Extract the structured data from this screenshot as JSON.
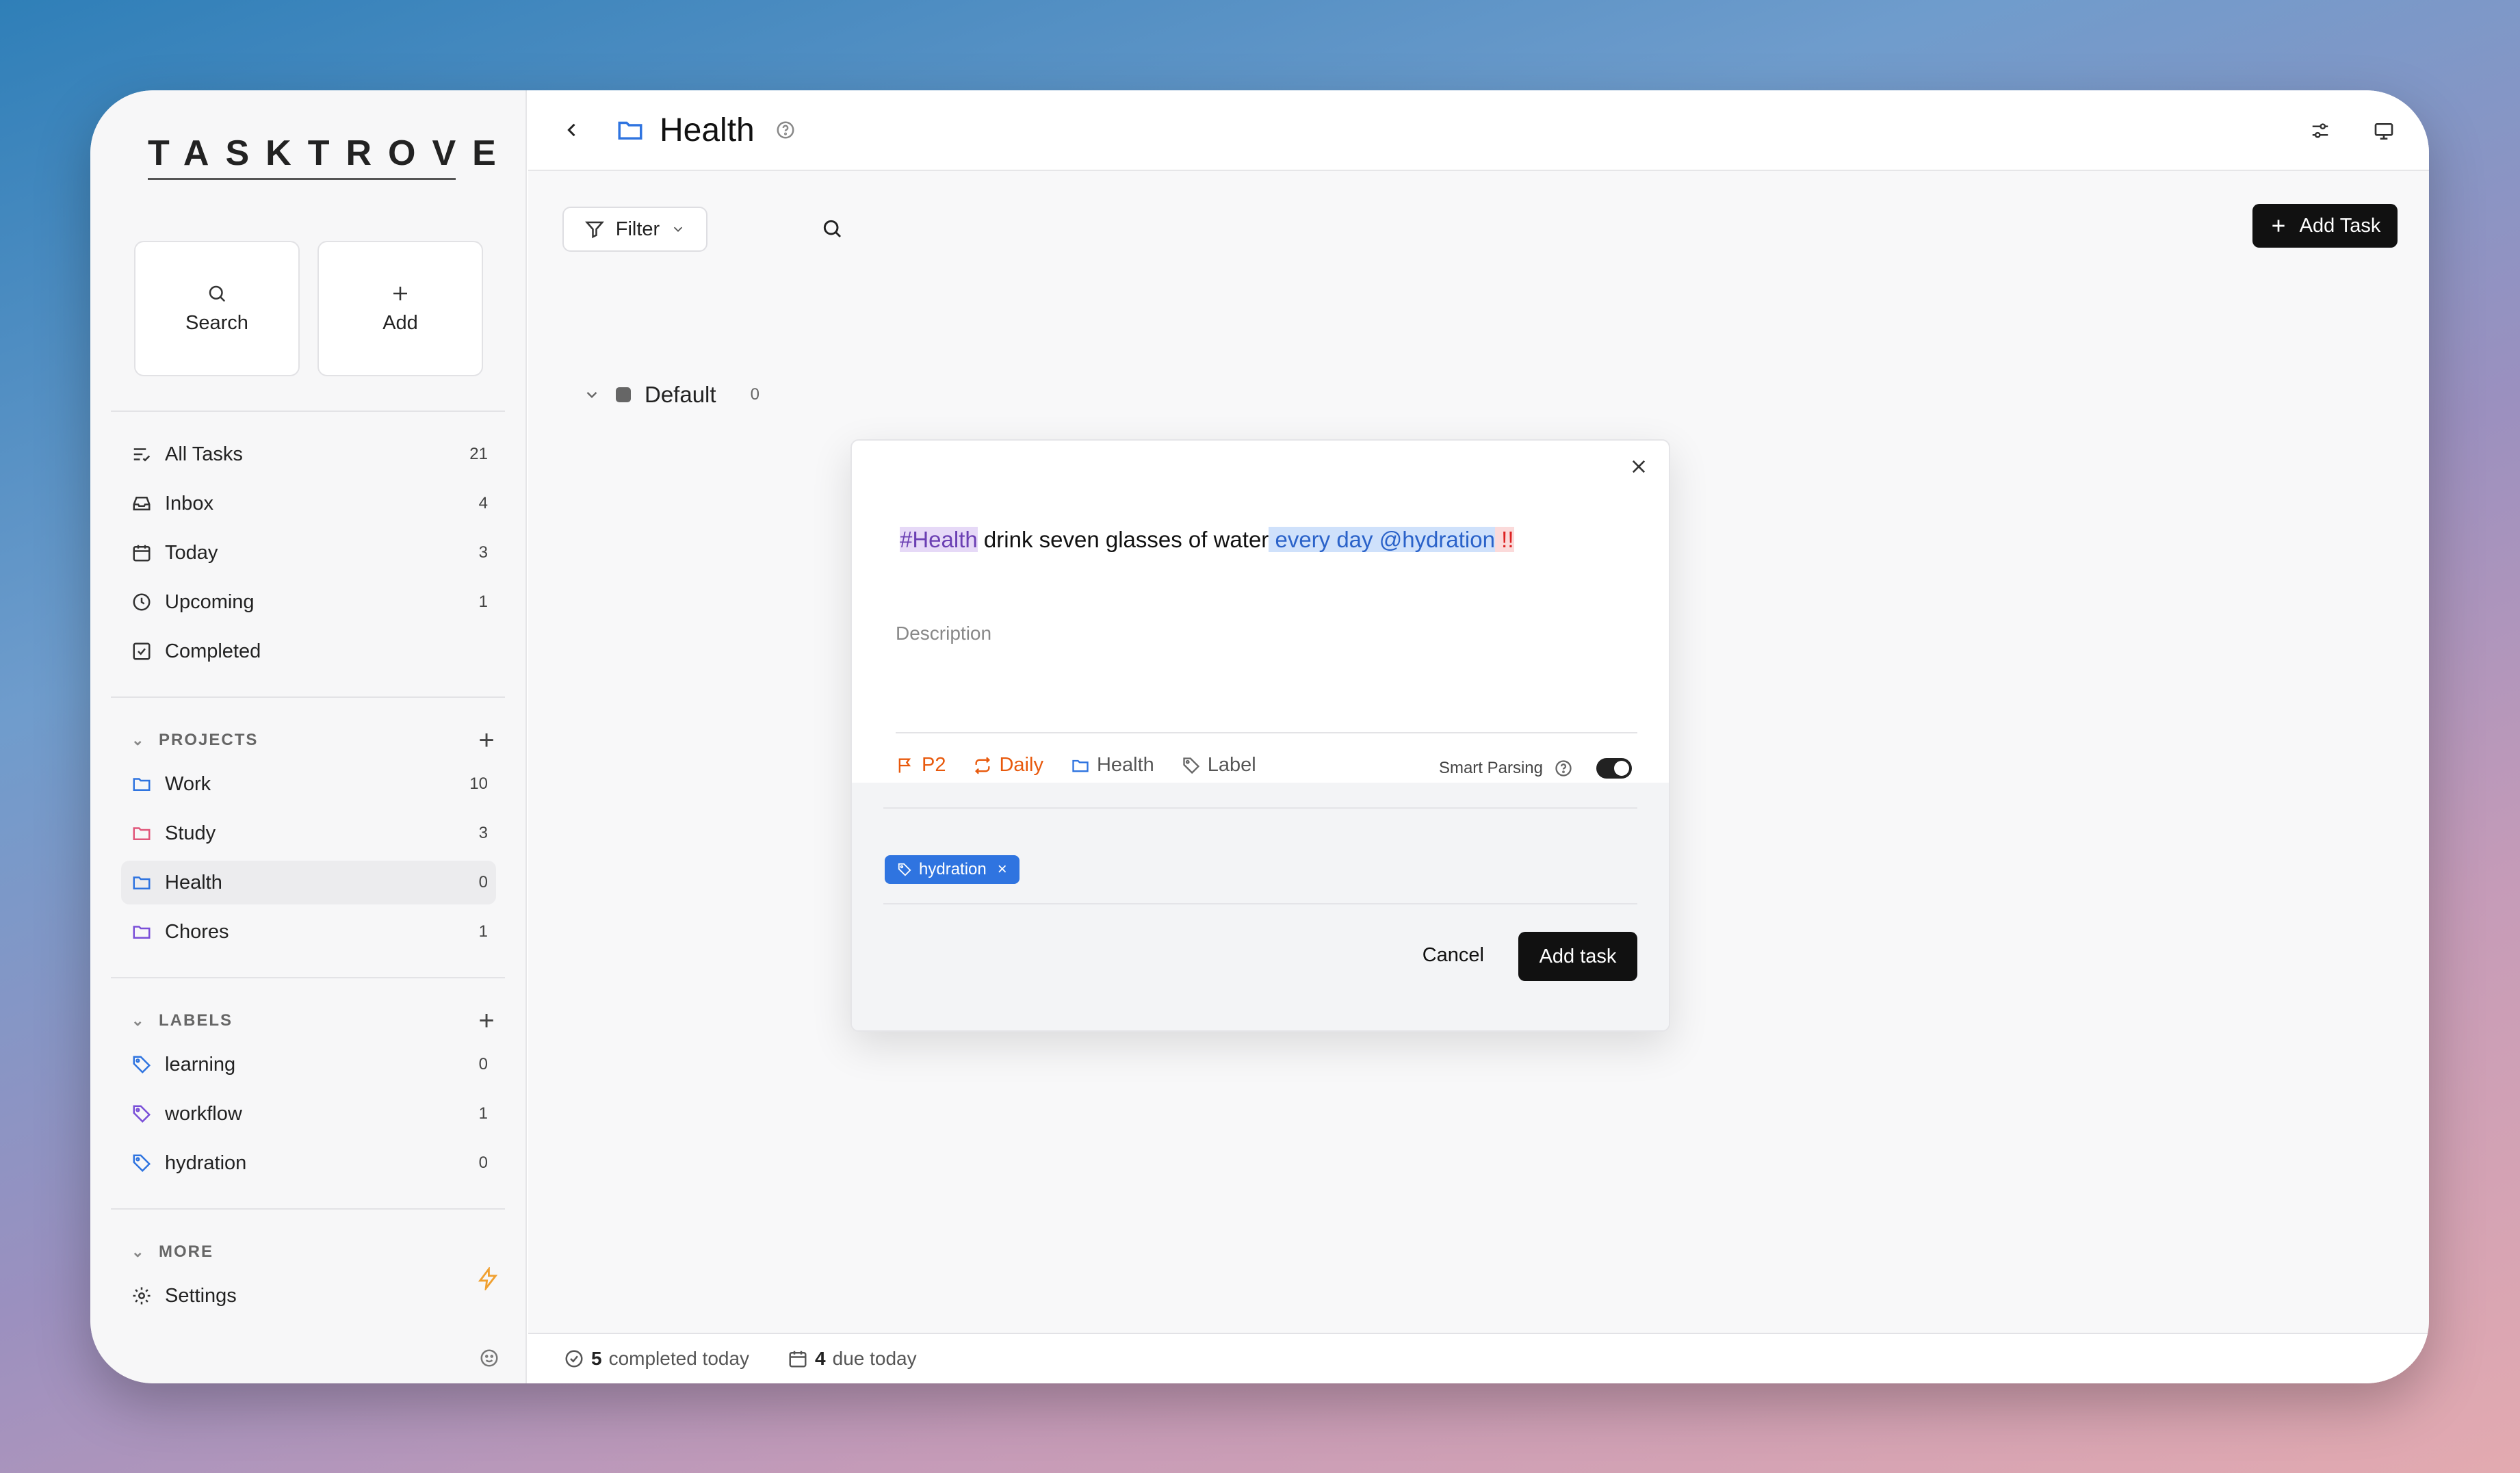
{
  "app": {
    "logo": "TASKTROVE"
  },
  "quick_actions": {
    "search_label": "Search",
    "add_label": "Add"
  },
  "nav": [
    {
      "label": "All Tasks",
      "count": "21",
      "icon": "list-check-icon"
    },
    {
      "label": "Inbox",
      "count": "4",
      "icon": "inbox-icon"
    },
    {
      "label": "Today",
      "count": "3",
      "icon": "calendar-icon"
    },
    {
      "label": "Upcoming",
      "count": "1",
      "icon": "clock-icon"
    },
    {
      "label": "Completed",
      "count": "",
      "icon": "check-square-icon"
    }
  ],
  "projects": {
    "heading": "PROJECTS",
    "items": [
      {
        "label": "Work",
        "count": "10",
        "color": "#2f74e0"
      },
      {
        "label": "Study",
        "count": "3",
        "color": "#e0567a"
      },
      {
        "label": "Health",
        "count": "0",
        "color": "#2f74e0"
      },
      {
        "label": "Chores",
        "count": "1",
        "color": "#7a4fd8"
      }
    ]
  },
  "labels": {
    "heading": "LABELS",
    "items": [
      {
        "label": "learning",
        "count": "0",
        "color": "#2f74e0"
      },
      {
        "label": "workflow",
        "count": "1",
        "color": "#7a4fd8"
      },
      {
        "label": "hydration",
        "count": "0",
        "color": "#2f74e0"
      }
    ]
  },
  "more": {
    "heading": "MORE",
    "settings_label": "Settings"
  },
  "header": {
    "title": "Health"
  },
  "toolbar": {
    "filter_label": "Filter",
    "add_task_label": "Add Task"
  },
  "group": {
    "name": "Default",
    "count": "0"
  },
  "footer": {
    "completed_count": "5",
    "completed_text": "completed today",
    "due_count": "4",
    "due_text": "due today"
  },
  "modal": {
    "tok_project": "#Health",
    "tok_text": " drink seven glasses of water",
    "tok_date": " every day",
    "tok_label": " @hydration",
    "tok_prio": " !!",
    "description_placeholder": "Description",
    "priority_chip": "P2",
    "recurrence_chip": "Daily",
    "project_chip": "Health",
    "label_chip": "Label",
    "smart_parsing_label": "Smart Parsing",
    "label_tag": "hydration",
    "cancel_label": "Cancel",
    "add_label": "Add task"
  },
  "colors": {
    "accent": "#2f74e0",
    "priority": "#e8590c",
    "dark": "#111111"
  }
}
